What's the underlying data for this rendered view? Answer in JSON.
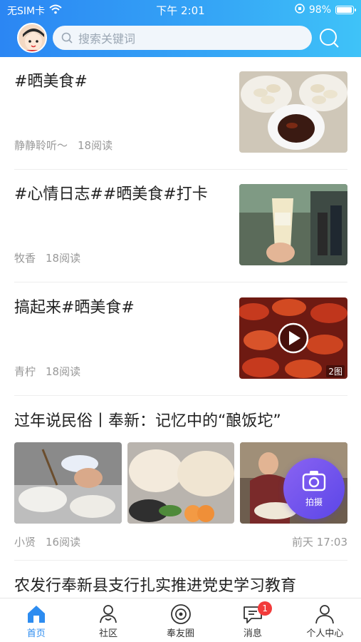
{
  "status_bar": {
    "carrier": "无SIM卡",
    "time": "下午 2:01",
    "battery": "98%",
    "battery_level": 0.98
  },
  "header": {
    "search_placeholder": "搜索关键词"
  },
  "feed": [
    {
      "title": "#晒美食#",
      "author": "静静聆听～",
      "reads": "18阅读"
    },
    {
      "title": "#心情日志##晒美食#打卡",
      "author": "牧香",
      "reads": "18阅读"
    },
    {
      "title": "搞起来#晒美食#",
      "author": "青柠",
      "reads": "18阅读",
      "image_count": "2图"
    },
    {
      "title": "过年说民俗丨奉新：记忆中的“酿饭坨”",
      "author": "小贤",
      "reads": "16阅读",
      "time": "前天 17:03"
    },
    {
      "title": "农发行奉新县支行扎实推进党史学习教育"
    }
  ],
  "fab": {
    "label": "拍摄"
  },
  "tabbar": {
    "items": [
      {
        "label": "首页",
        "icon": "home-icon",
        "active": true
      },
      {
        "label": "社区",
        "icon": "community-icon"
      },
      {
        "label": "奉友圈",
        "icon": "circle-icon"
      },
      {
        "label": "消息",
        "icon": "message-icon",
        "badge": "1"
      },
      {
        "label": "个人中心",
        "icon": "profile-icon"
      }
    ]
  },
  "colors": {
    "accent": "#2d8cf0",
    "header_start": "#2b86f3",
    "header_end": "#3fc3f8",
    "badge": "#f23b3b",
    "fab": "#6a4ff0"
  }
}
